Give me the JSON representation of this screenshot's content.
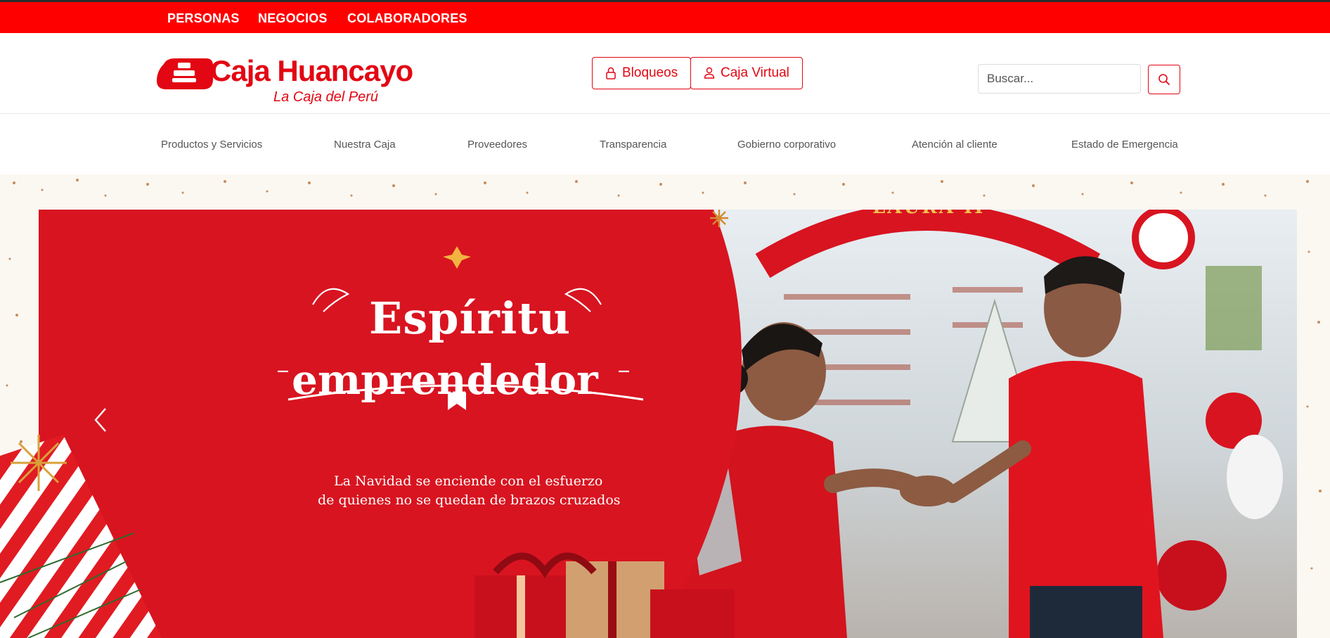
{
  "topbar": {
    "items": [
      "PERSONAS",
      "NEGOCIOS",
      "COLABORADORES"
    ]
  },
  "header": {
    "logo_name": "Caja Huancayo",
    "logo_tagline": "La Caja del Perú",
    "buttons": {
      "bloqueos": "Bloqueos",
      "caja_virtual": "Caja Virtual"
    },
    "search": {
      "placeholder": "Buscar..."
    }
  },
  "nav": {
    "items": [
      "Productos y Servicios",
      "Nuestra Caja",
      "Proveedores",
      "Transparencia",
      "Gobierno corporativo",
      "Atención al cliente",
      "Estado de Emergencia"
    ]
  },
  "hero": {
    "headline_line1": "Espíritu",
    "headline_line2": "emprendedor",
    "subtitle_line1": "La Navidad se enciende con el esfuerzo",
    "subtitle_line2": "de quienes no se quedan de brazos cruzados",
    "arch_sign": "LAURA II"
  },
  "colors": {
    "brand_red": "#e30613",
    "topbar_red": "#ff0000",
    "banner_red": "#d81420"
  },
  "icons": {
    "bloqueos": "lock-icon",
    "caja_virtual": "user-icon",
    "search": "search-icon",
    "carousel_prev": "chevron-left-icon"
  }
}
